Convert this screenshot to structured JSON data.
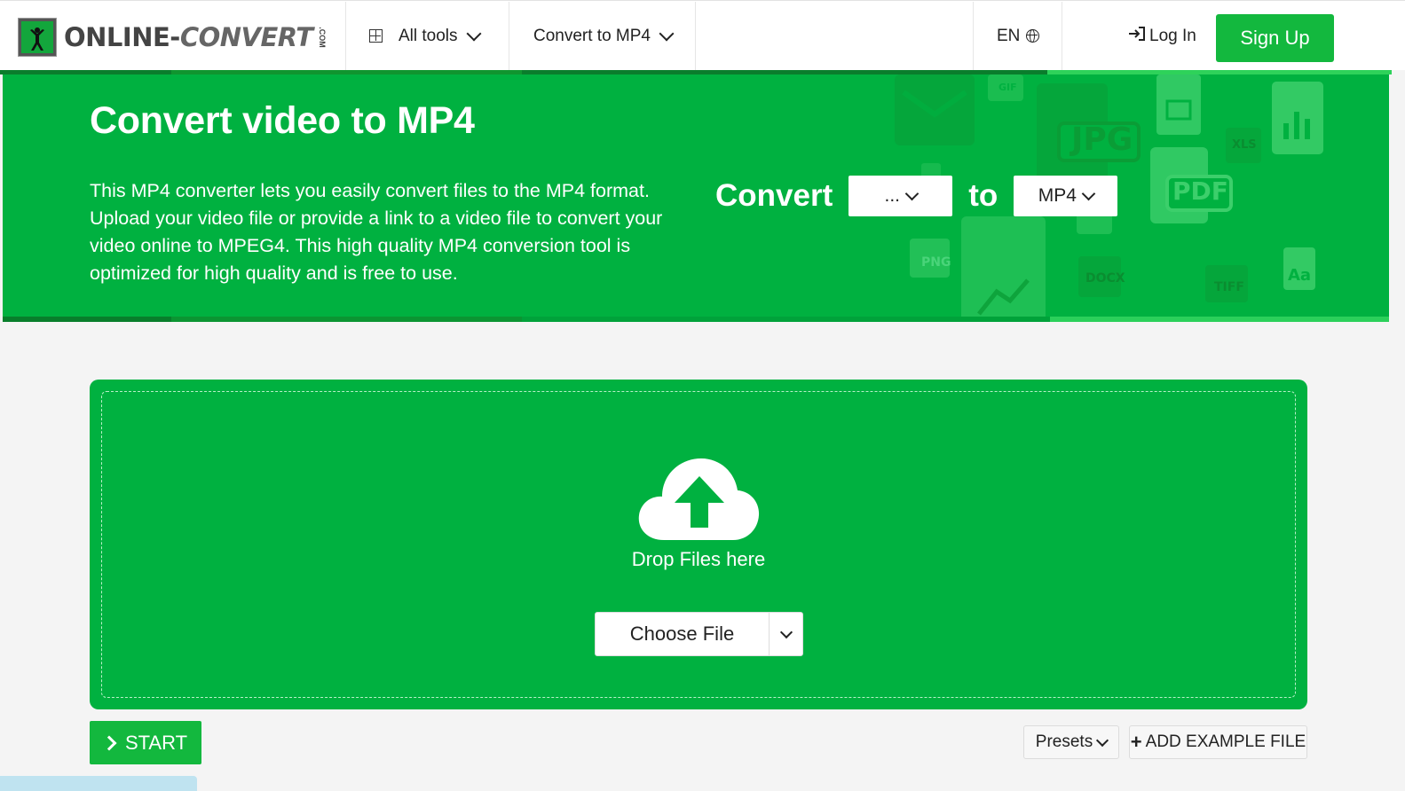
{
  "header": {
    "logo": {
      "part1": "ONLINE-",
      "part2": "CONVERT",
      "suffix": ".COM"
    },
    "all_tools": "All tools",
    "convert_menu": "Convert to MP4",
    "language": "EN",
    "login": "Log In",
    "signup": "Sign Up"
  },
  "hero": {
    "title": "Convert video to MP4",
    "description": "This MP4 converter lets you easily convert files to the MP4 format. Upload your video file or provide a link to a video file to convert your video online to MPEG4. This high quality MP4 conversion tool is optimized for high quality and is free to use.",
    "convert_label": "Convert",
    "from_value": "...",
    "to_label": "to",
    "to_value": "MP4",
    "deco_labels": {
      "jpg": "JPG",
      "pdf": "PDF",
      "png": "PNG",
      "aa": "Aa",
      "docx": "DOCX",
      "tiff": "TIFF",
      "xls": "XLS",
      "gif": "GIF"
    }
  },
  "upload": {
    "drop_text": "Drop Files here",
    "choose_file": "Choose File"
  },
  "actions": {
    "start": "START",
    "presets": "Presets",
    "add_example": "ADD EXAMPLE FILE"
  },
  "colors": {
    "brand_green": "#00b140",
    "button_green": "#13b83e"
  }
}
